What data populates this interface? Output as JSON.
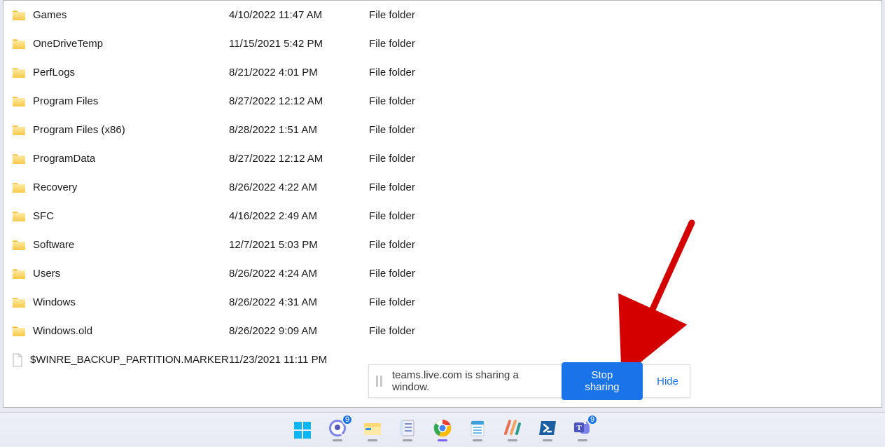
{
  "rows": [
    {
      "kind": "folder",
      "name": "Games",
      "date": "4/10/2022 11:47 AM",
      "type": "File folder"
    },
    {
      "kind": "folder",
      "name": "OneDriveTemp",
      "date": "11/15/2021 5:42 PM",
      "type": "File folder"
    },
    {
      "kind": "folder",
      "name": "PerfLogs",
      "date": "8/21/2022 4:01 PM",
      "type": "File folder"
    },
    {
      "kind": "folder",
      "name": "Program Files",
      "date": "8/27/2022 12:12 AM",
      "type": "File folder"
    },
    {
      "kind": "folder",
      "name": "Program Files (x86)",
      "date": "8/28/2022 1:51 AM",
      "type": "File folder"
    },
    {
      "kind": "folder",
      "name": "ProgramData",
      "date": "8/27/2022 12:12 AM",
      "type": "File folder"
    },
    {
      "kind": "folder",
      "name": "Recovery",
      "date": "8/26/2022 4:22 AM",
      "type": "File folder"
    },
    {
      "kind": "folder",
      "name": "SFC",
      "date": "4/16/2022 2:49 AM",
      "type": "File folder"
    },
    {
      "kind": "folder",
      "name": "Software",
      "date": "12/7/2021 5:03 PM",
      "type": "File folder"
    },
    {
      "kind": "folder",
      "name": "Users",
      "date": "8/26/2022 4:24 AM",
      "type": "File folder"
    },
    {
      "kind": "folder",
      "name": "Windows",
      "date": "8/26/2022 4:31 AM",
      "type": "File folder"
    },
    {
      "kind": "folder",
      "name": "Windows.old",
      "date": "8/26/2022 9:09 AM",
      "type": "File folder"
    },
    {
      "kind": "file",
      "name": "$WINRE_BACKUP_PARTITION.MARKER",
      "date": "11/23/2021 11:11 PM",
      "type": ""
    }
  ],
  "share_bar": {
    "message": "teams.live.com is sharing a window.",
    "stop_label": "Stop sharing",
    "hide_label": "Hide"
  },
  "taskbar": {
    "items": [
      {
        "id": "start",
        "badge": ""
      },
      {
        "id": "teams-chat",
        "badge": "9"
      },
      {
        "id": "file-explorer",
        "badge": ""
      },
      {
        "id": "onenote",
        "badge": ""
      },
      {
        "id": "chrome",
        "badge": "",
        "active": true
      },
      {
        "id": "notepad",
        "badge": ""
      },
      {
        "id": "windows-tool",
        "badge": ""
      },
      {
        "id": "powershell",
        "badge": ""
      },
      {
        "id": "teams",
        "badge": "9"
      }
    ]
  }
}
